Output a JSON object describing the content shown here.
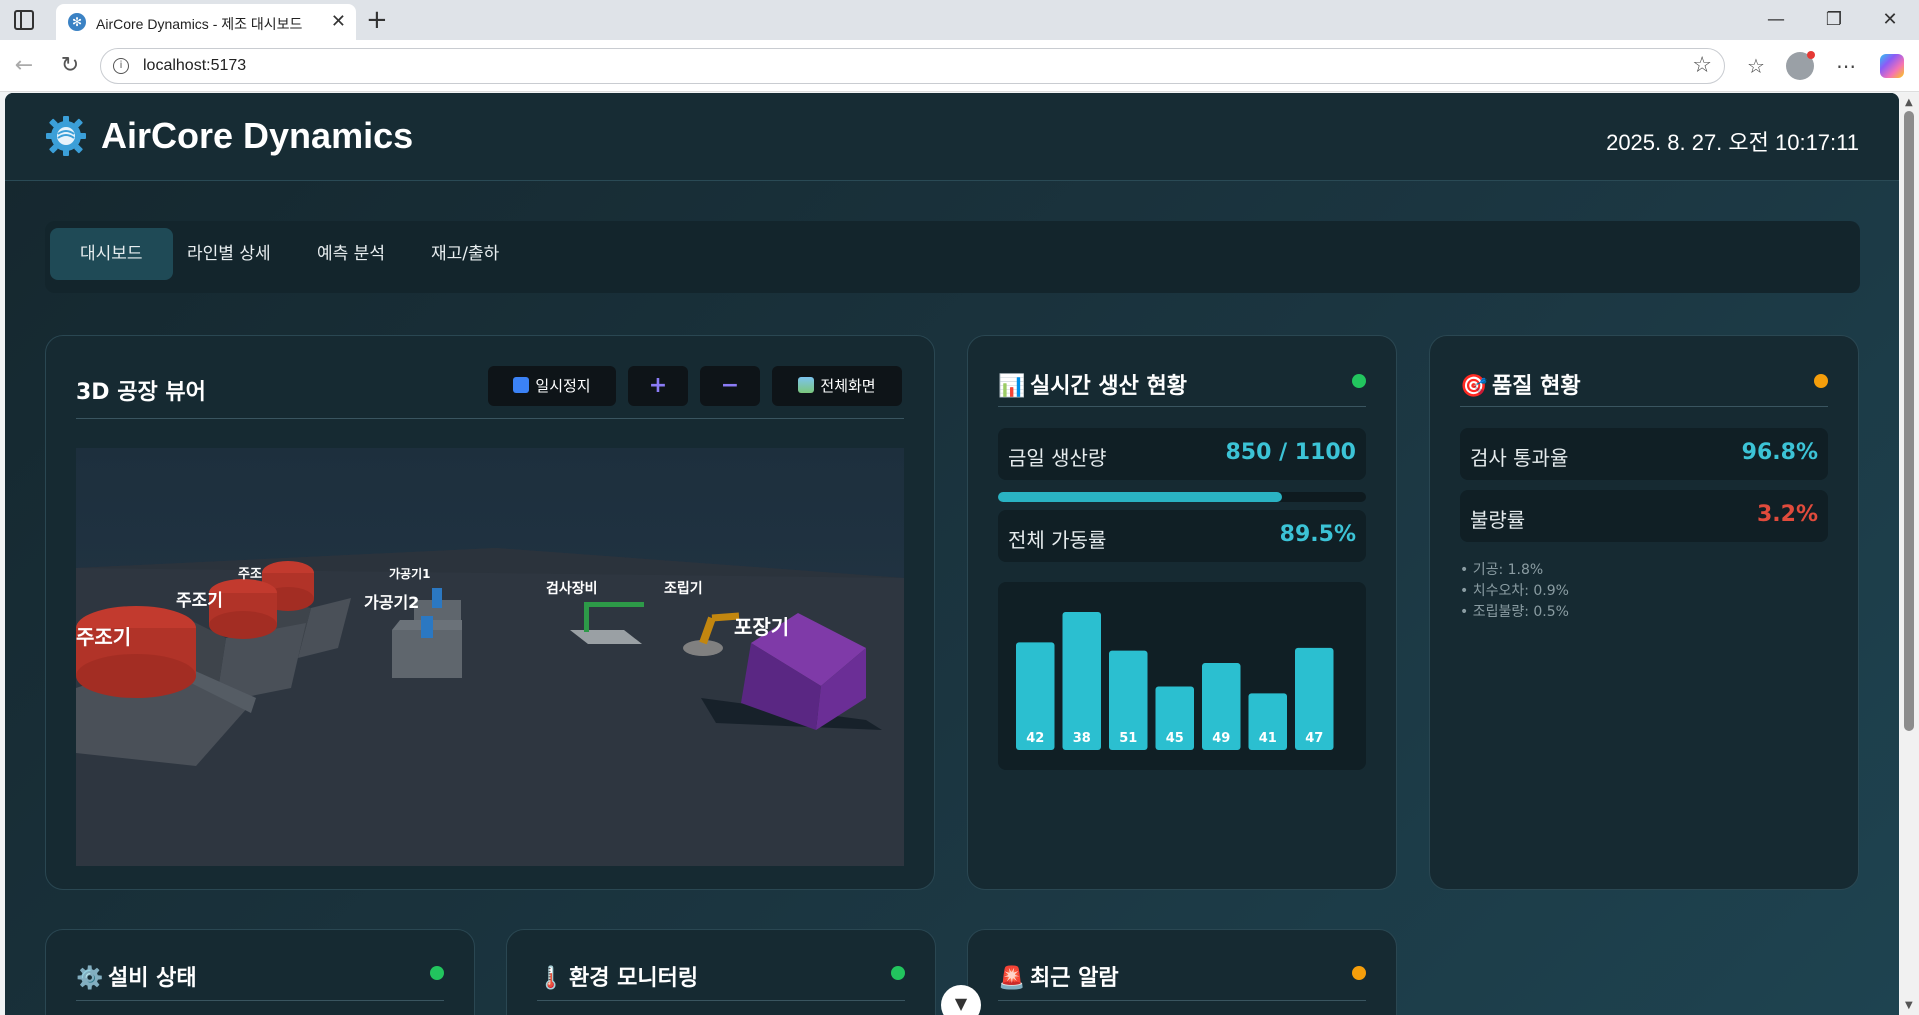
{
  "browser": {
    "tab_title": "AirCore Dynamics - 제조 대시보드",
    "url": "localhost:5173"
  },
  "header": {
    "title": "AirCore Dynamics",
    "datetime": "2025. 8. 27. 오전 10:17:11"
  },
  "nav": {
    "items": [
      {
        "label": "대시보드",
        "active": true
      },
      {
        "label": "라인별 상세",
        "active": false
      },
      {
        "label": "예측 분석",
        "active": false
      },
      {
        "label": "재고/출하",
        "active": false
      }
    ]
  },
  "viewer": {
    "title": "3D 공장 뷰어",
    "pause_label": "일시정지",
    "zoom_in_label": "+",
    "zoom_out_label": "−",
    "fullscreen_label": "전체화면",
    "machine_labels": {
      "casting_front": "주조기",
      "casting_mid": "주조기",
      "casting_back": "주조",
      "machining1": "가공기1",
      "machining2": "가공기2",
      "inspection": "검사장비",
      "assembly": "조립기",
      "packaging": "포장기"
    }
  },
  "production": {
    "title": "실시간 생산 현황",
    "status_color": "#22c55e",
    "today_label": "금일 생산량",
    "today_value": "850 / 1100",
    "progress_fraction": 0.7727,
    "uptime_label": "전체 가동률",
    "uptime_value": "89.5%"
  },
  "chart_data": {
    "type": "bar",
    "values": [
      42,
      38,
      51,
      45,
      49,
      41,
      47
    ],
    "bar_heights_relative": [
      0.78,
      1.0,
      0.72,
      0.46,
      0.63,
      0.41,
      0.74
    ],
    "color": "#2bbfd0"
  },
  "quality": {
    "title": "품질 현황",
    "status_color": "#f59e0b",
    "pass_label": "검사 통과율",
    "pass_value": "96.8%",
    "defect_label": "불량률",
    "defect_value": "3.2%",
    "breakdown": [
      "• 기공: 1.8%",
      "• 치수오차: 0.9%",
      "• 조립불량: 0.5%"
    ]
  },
  "equipment": {
    "title": "설비 상태",
    "status_color": "#22c55e"
  },
  "environment": {
    "title": "환경 모니터링",
    "status_color": "#22c55e"
  },
  "alarms": {
    "title": "최근 알람",
    "status_color": "#f59e0b"
  },
  "colors": {
    "accent": "#3cc3d6",
    "danger": "#e04b3c",
    "bg": "#162a32"
  }
}
